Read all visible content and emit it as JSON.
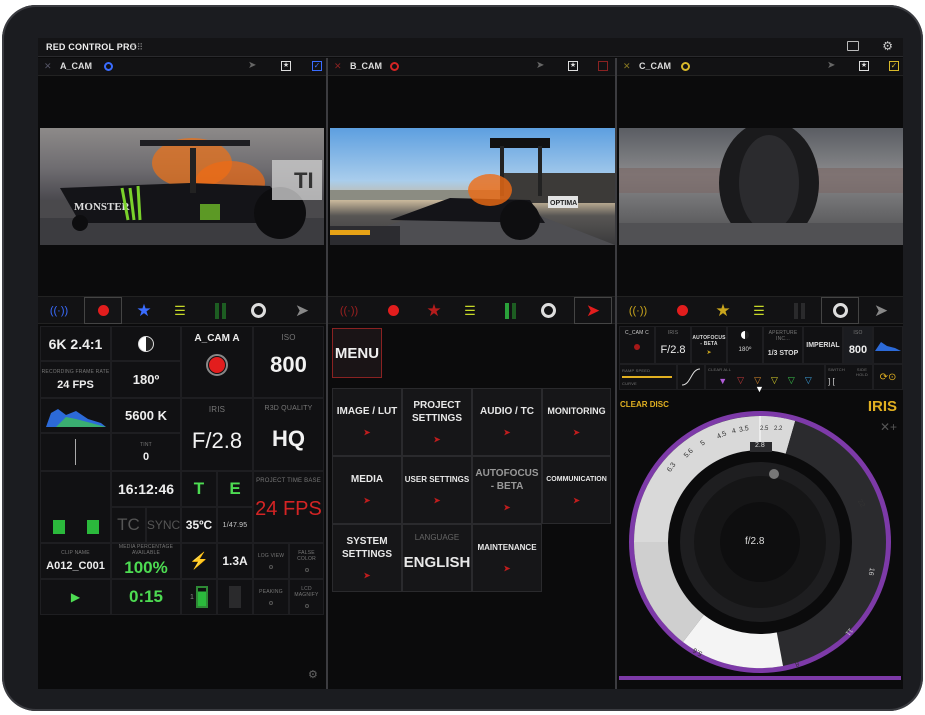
{
  "app": {
    "title": "RED CONTROL PRO"
  },
  "cameras": [
    {
      "name": "A_CAM",
      "accent": "#3a6cff"
    },
    {
      "name": "B_CAM",
      "accent": "#d42424"
    },
    {
      "name": "C_CAM",
      "accent": "#d8b92a"
    }
  ],
  "acam": {
    "format": "6K 2.4:1",
    "fps_label": "RECORDING FRAME RATE",
    "fps": "24 FPS",
    "shutter": "180º",
    "cam_label": "A_CAM A",
    "iso_label": "ISO",
    "iso": "800",
    "wb": "5600 K",
    "tint_label": "TINT",
    "tint": "0",
    "iris_label": "IRIS",
    "iris": "F/2.8",
    "quality_label": "R3D QUALITY",
    "quality": "HQ",
    "timecode": "16:12:46",
    "t_label": "T",
    "e_label": "E",
    "tc_label": "TC",
    "sync_label": "SYNC",
    "temp": "35ºC",
    "framerate_small": "1/47.95",
    "timebase_label": "PROJECT TIME BASE",
    "timebase": "24 FPS",
    "clip_label": "CLIP NAME",
    "clip": "A012_C001",
    "media_label": "MEDIA PERCENTAGE AVAILABLE",
    "media": "100%",
    "current": "1.3A",
    "logview_label": "LOG VIEW",
    "falsecolor_label": "FALSE COLOR",
    "remaining": "0:15",
    "battery_count": "1",
    "peaking_label": "PEAKING",
    "lcdmagnify_label": "LCD MAGNIFY"
  },
  "bcam": {
    "menu_title": "MENU",
    "items": [
      {
        "label": "IMAGE / LUT"
      },
      {
        "label": "PROJECT SETTINGS"
      },
      {
        "label": "AUDIO / TC"
      },
      {
        "label": "MONITORING"
      },
      {
        "label": "MEDIA"
      },
      {
        "label": "USER SETTINGS"
      },
      {
        "label": "AUTOFOCUS - BETA"
      },
      {
        "label": "COMMUNICATION"
      },
      {
        "label": "SYSTEM SETTINGS"
      },
      {
        "label": "MAINTENANCE"
      }
    ],
    "language_label": "LANGUAGE",
    "language": "ENGLISH"
  },
  "ccam": {
    "cam_label": "C_CAM C",
    "iris_label": "IRIS",
    "iris": "F/2.8",
    "autofocus": "AUTOFOCUS - BETA",
    "shutter": "180º",
    "aperture_label": "APERTURE INC...",
    "aperture": "1/3 STOP",
    "units": "IMPERIAL",
    "iso_label": "ISO",
    "iso": "800",
    "ramp_label": "RAMP SPEED",
    "curve_label": "CURVE",
    "normal_label": "NORMAL",
    "clear_all": "CLEAR ALL",
    "switch_label": "SWITCH",
    "side_label": "SIDE HOLD",
    "clear_disc": "CLEAR DISC",
    "iris_title": "IRIS",
    "center_value": "f/2.8",
    "dial_marks": [
      "6.3",
      "5.6",
      "5",
      "4.5",
      "4",
      "3.5",
      "2.5",
      "2.2",
      "2.8",
      "22",
      "16",
      "11",
      "8",
      "5.6"
    ]
  }
}
